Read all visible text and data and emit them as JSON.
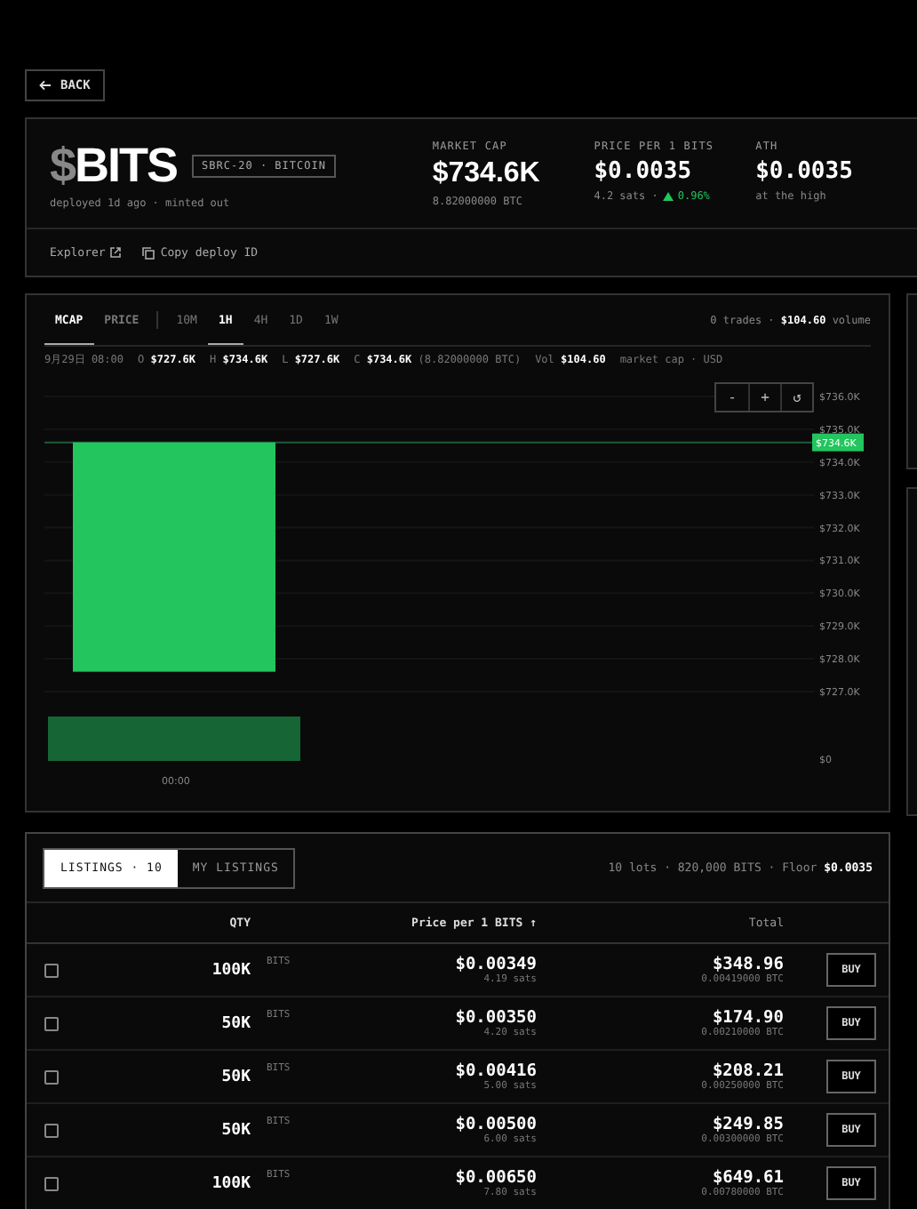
{
  "back_button": {
    "label": "BACK"
  },
  "token": {
    "symbol_prefix": "$",
    "symbol": "BITS",
    "tag": "SBRC-20 · BITCOIN",
    "subtitle": "deployed 1d ago · minted out",
    "stats": [
      {
        "label": "MARKET CAP",
        "value": "$734.6K",
        "sub": "8.82000000 BTC"
      },
      {
        "label": "PRICE PER 1 BITS",
        "value": "$0.0035",
        "sub": "4.2 sats ·",
        "change": "0.96%",
        "rising": true
      },
      {
        "label": "ATH",
        "value": "$0.0035",
        "sub": "at the high"
      }
    ],
    "links": [
      {
        "kind": "external",
        "label": "Explorer"
      },
      {
        "kind": "copy",
        "label": "Copy deploy ID"
      }
    ]
  },
  "chart": {
    "modes": [
      {
        "label": "MCAP",
        "selected": true
      },
      {
        "label": "PRICE",
        "selected": false
      }
    ],
    "intervals": [
      {
        "label": "10M",
        "selected": false
      },
      {
        "label": "1H",
        "selected": true
      },
      {
        "label": "4H",
        "selected": false
      },
      {
        "label": "1D",
        "selected": false
      },
      {
        "label": "1W",
        "selected": false
      }
    ],
    "summary": "0 trades · **$104.60** volume",
    "ohlc": [
      "9月29日 08:00",
      "O **$727.6K**",
      "H **$734.6K**",
      "L **$727.6K**",
      "C **$734.6K** (8.82000000 BTC)",
      "Vol **$104.60**",
      "market cap · USD"
    ],
    "zoom_controls": [
      "-",
      "+",
      "↺"
    ],
    "y_labels": [
      "$736.0K",
      "$735.0K",
      "$734.0K",
      "$733.0K",
      "$732.0K",
      "$731.0K",
      "$730.0K",
      "$729.0K",
      "$728.0K",
      "$727.0K"
    ],
    "price_badge": "$734.6K",
    "volume_label": "$0",
    "x_labels": [
      "00:00"
    ]
  },
  "listings": {
    "tabs": [
      {
        "label": "LISTINGS · 10",
        "selected": true
      },
      {
        "label": "MY LISTINGS",
        "selected": false
      }
    ],
    "summary": "10 lots · 820,000 BITS · Floor **$0.0035**",
    "columns": [
      "QTY",
      "Price per 1 BITS ↑",
      "Total"
    ],
    "rows": [
      {
        "checked": false,
        "qty": "100K",
        "unit": "BITS",
        "price": "$0.00349",
        "sats": "4.19 sats",
        "total": "$348.96",
        "btc": "0.00419000 BTC",
        "action": "BUY"
      },
      {
        "checked": false,
        "qty": "50K",
        "unit": "BITS",
        "price": "$0.00350",
        "sats": "4.20 sats",
        "total": "$174.90",
        "btc": "0.00210000 BTC",
        "action": "BUY"
      },
      {
        "checked": false,
        "qty": "50K",
        "unit": "BITS",
        "price": "$0.00416",
        "sats": "5.00 sats",
        "total": "$208.21",
        "btc": "0.00250000 BTC",
        "action": "BUY"
      },
      {
        "checked": false,
        "qty": "50K",
        "unit": "BITS",
        "price": "$0.00500",
        "sats": "6.00 sats",
        "total": "$249.85",
        "btc": "0.00300000 BTC",
        "action": "BUY"
      },
      {
        "checked": false,
        "qty": "100K",
        "unit": "BITS",
        "price": "$0.00650",
        "sats": "7.80 sats",
        "total": "$649.61",
        "btc": "0.00780000 BTC",
        "action": "BUY"
      }
    ]
  }
}
